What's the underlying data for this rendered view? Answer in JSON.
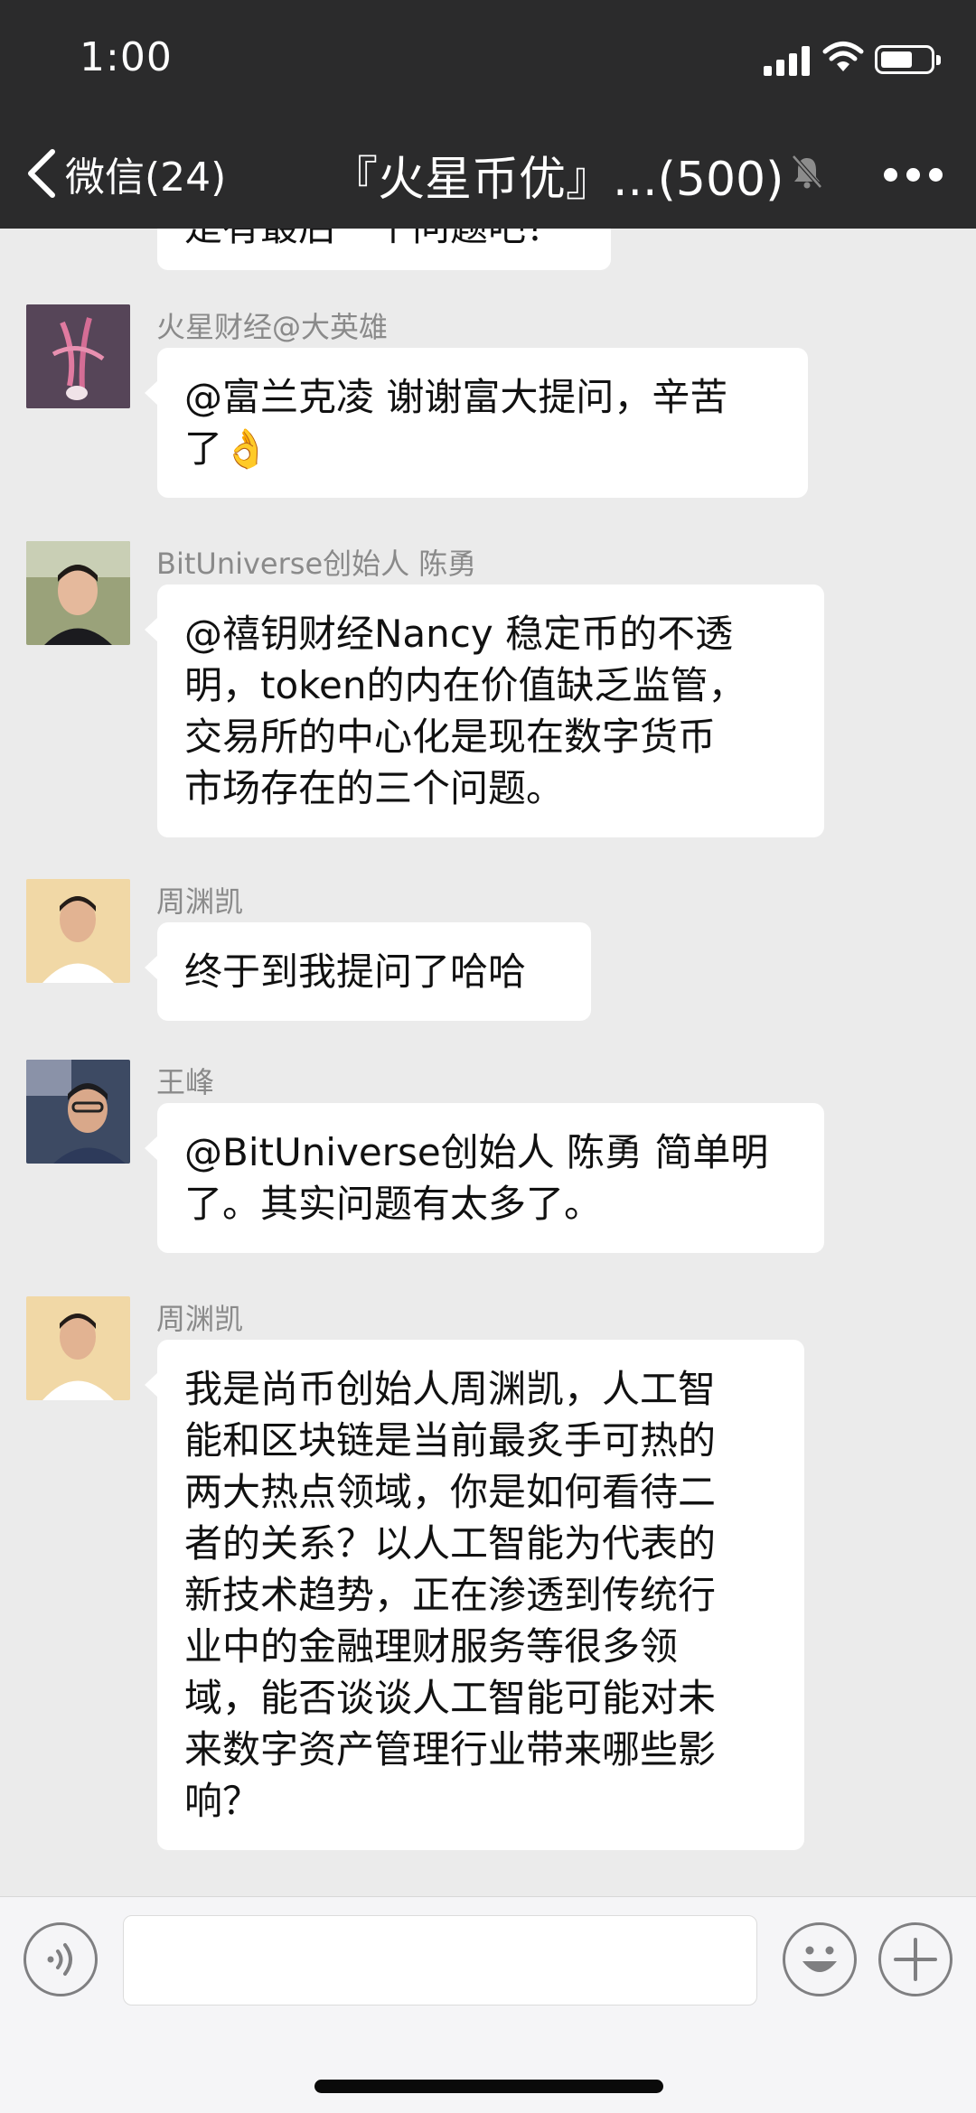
{
  "status_bar": {
    "time": "1:00"
  },
  "nav": {
    "back_label": "微信(24)",
    "title": "『火星币优』...(500)"
  },
  "messages": [
    {
      "sender": "",
      "lines": [
        "是有最后一个问题吧？"
      ]
    },
    {
      "sender": "火星财经@大英雄",
      "lines": [
        "@富兰克凌 谢谢富大提问，辛苦",
        "了👌"
      ]
    },
    {
      "sender": "BitUniverse创始人 陈勇",
      "lines": [
        "@禧钥财经Nancy 稳定币的不透",
        "明，token的内在价值缺乏监管，",
        "交易所的中心化是现在数字货币",
        "市场存在的三个问题。"
      ]
    },
    {
      "sender": "周渊凯",
      "lines": [
        "终于到我提问了哈哈"
      ]
    },
    {
      "sender": "王峰",
      "lines": [
        "@BitUniverse创始人 陈勇 简单明",
        "了。其实问题有太多了。"
      ]
    },
    {
      "sender": "周渊凯",
      "lines": [
        "我是尚币创始人周渊凯，人工智",
        "能和区块链是当前最炙手可热的",
        "两大热点领域，你是如何看待二",
        "者的关系？以人工智能为代表的",
        "新技术趋势，正在渗透到传统行",
        "业中的金融理财服务等很多领",
        "域，能否谈谈人工智能可能对未",
        "来数字资产管理行业带来哪些影",
        "响？"
      ]
    }
  ],
  "input": {
    "placeholder": ""
  },
  "colors": {
    "header_bg": "#2b2b2c",
    "chat_bg": "#ebebeb",
    "bubble_bg": "#ffffff",
    "sender_text": "#8a8a8a"
  },
  "icons": [
    "chevron-left-icon",
    "signal-icon",
    "wifi-icon",
    "battery-icon",
    "mute-bell-icon",
    "more-dots-icon",
    "voice-icon",
    "emoji-icon",
    "plus-icon"
  ]
}
